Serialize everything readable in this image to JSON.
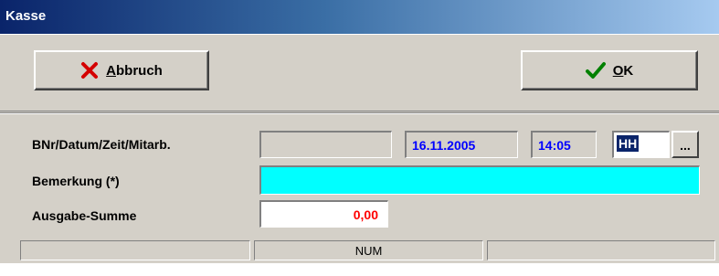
{
  "window": {
    "title": "Kasse"
  },
  "toolbar": {
    "cancel_label": "Abbruch",
    "ok_label": "OK",
    "cancel_icon": "red-x-icon",
    "ok_icon": "green-checkmark-icon"
  },
  "form": {
    "row1_label": "BNr/Datum/Zeit/Mitarb.",
    "bnr_value": "",
    "date_value": "16.11.2005",
    "time_value": "14:05",
    "employee_value": "HH",
    "browse_label": "...",
    "remark_label": "Bemerkung (*)",
    "remark_value": "",
    "sum_label": "Ausgabe-Summe",
    "sum_value": "0,00"
  },
  "statusbar": {
    "panel1": "",
    "panel2": "NUM",
    "panel3": ""
  },
  "colors": {
    "remark_bg": "#00ffff",
    "sum_text": "#ff0000",
    "date_text": "#0000ff",
    "selection": "#0a246a"
  }
}
